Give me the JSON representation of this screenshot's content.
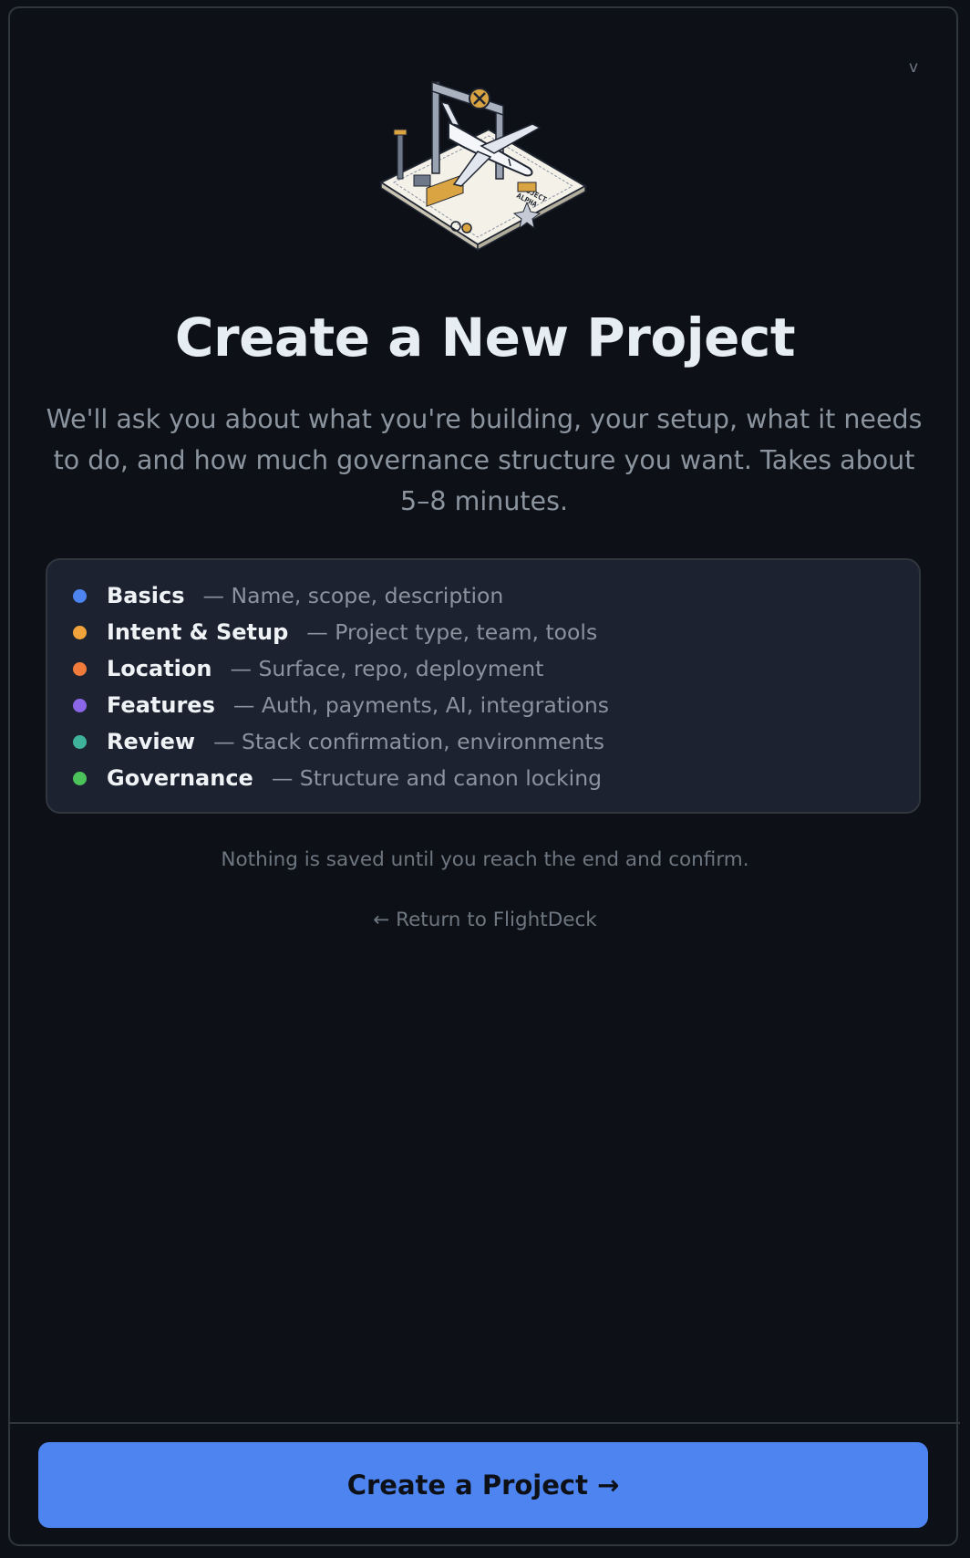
{
  "header": {
    "toggle_glyph": "v"
  },
  "hero": {
    "illustration": "isometric-airplane-blueprint-illustration",
    "blueprint_label": [
      "PROJECT",
      "ALPHA"
    ]
  },
  "title": "Create a New Project",
  "subtitle": "We'll ask you about what you're building, your setup, what it needs to do, and how much governance structure you want. Takes about 5–8 minutes.",
  "steps": [
    {
      "name": "Basics",
      "desc": "— Name, scope, description",
      "color": "#4d84ef"
    },
    {
      "name": "Intent & Setup",
      "desc": "— Project type, team, tools",
      "color": "#f0a23b"
    },
    {
      "name": "Location",
      "desc": "— Surface, repo, deployment",
      "color": "#f07b3b"
    },
    {
      "name": "Features",
      "desc": "— Auth, payments, AI, integrations",
      "color": "#8b67e8"
    },
    {
      "name": "Review",
      "desc": "— Stack confirmation, environments",
      "color": "#3eb29a"
    },
    {
      "name": "Governance",
      "desc": "— Structure and canon locking",
      "color": "#4cc25a"
    }
  ],
  "note": "Nothing is saved until you reach the end and confirm.",
  "back_link": {
    "arrow": "←",
    "label": "Return to FlightDeck"
  },
  "cta": {
    "label": "Create a Project",
    "arrow": "→",
    "color": "#4d84ef"
  }
}
